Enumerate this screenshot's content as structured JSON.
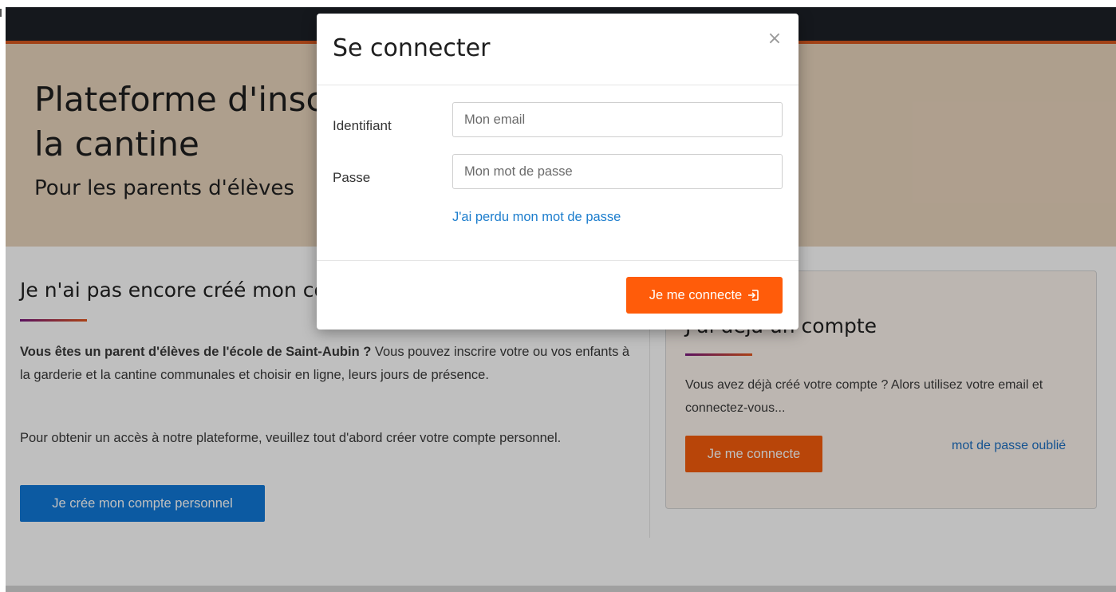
{
  "hero": {
    "title": "Plateforme d'inscription à la garderie et à la cantine",
    "subtitle": "Pour les parents d'élèves"
  },
  "left": {
    "heading": "Je n'ai pas encore créé mon compte",
    "p1_bold": "Vous êtes un parent d'élèves de l'école de Saint-Aubin ?",
    "p1_rest": " Vous pouvez inscrire votre ou vos enfants à la garderie et la cantine communales et choisir en ligne, leurs jours de présence.",
    "p2": "Pour obtenir un accès à notre plateforme, veuillez tout d'abord créer votre compte personnel.",
    "create_button": "Je crée mon compte personnel"
  },
  "card": {
    "heading": "J'ai déjà un compte",
    "text": "Vous avez déjà créé votre compte ? Alors utilisez votre email et connectez-vous...",
    "connect_button": "Je me connecte",
    "forgot_link": "mot de passe oublié"
  },
  "modal": {
    "title": "Se connecter",
    "close": "×",
    "identifiant_label": "Identifiant",
    "email_placeholder": "Mon email",
    "passe_label": "Passe",
    "password_placeholder": "Mon mot de passe",
    "lost_password_link": "J'ai perdu mon mot de passe",
    "submit_button": "Je me connecte",
    "submit_icon": "sign-in-icon"
  },
  "colors": {
    "topbar": "#1c2127",
    "accent_orange": "#ff5c0a",
    "link_blue": "#1c7dcd",
    "button_blue": "#1179d8",
    "hero_bg": "#e9d4bd"
  }
}
